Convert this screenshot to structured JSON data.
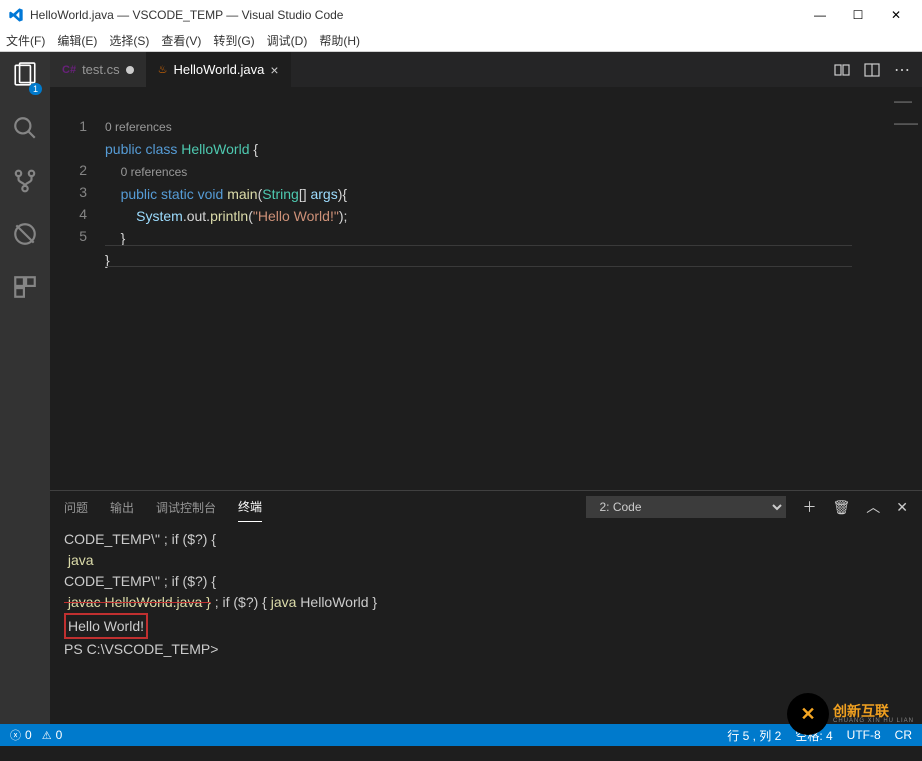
{
  "titlebar": {
    "title": "HelloWorld.java — VSCODE_TEMP — Visual Studio Code"
  },
  "menu": {
    "file": "文件(F)",
    "edit": "编辑(E)",
    "select": "选择(S)",
    "view": "查看(V)",
    "goto": "转到(G)",
    "debug": "调试(D)",
    "help": "帮助(H)"
  },
  "activity": {
    "explorer_badge": "1"
  },
  "tabs": {
    "t1_icon": "C#",
    "t1_label": "test.cs",
    "t2_label": "HelloWorld.java"
  },
  "code": {
    "ref0": "0 references",
    "ref1": "0 references",
    "l1_public": "public",
    "l1_class": "class",
    "l1_name": "HelloWorld",
    "l1_brace": "{",
    "l2_public": "public",
    "l2_static": "static",
    "l2_void": "void",
    "l2_main": "main",
    "l2_p1": "(",
    "l2_String": "String",
    "l2_arr": "[]",
    "l2_args": "args",
    "l2_p2": ")",
    "l2_brace": "{",
    "l3_sys": "System",
    "l3_out": ".out.",
    "l3_pl": "println",
    "l3_p1": "(",
    "l3_str": "\"Hello World!\"",
    "l3_p2": ");",
    "l4": "}",
    "l5": "}",
    "n1": "1",
    "n2": "2",
    "n3": "3",
    "n4": "4",
    "n5": "5"
  },
  "panel": {
    "tab_problems": "问题",
    "tab_output": "输出",
    "tab_debug": "调试控制台",
    "tab_terminal": "终端",
    "select": "2: Code"
  },
  "terminal": {
    "l1a": "CODE_TEMP\\\" ; if ($?) {",
    "l2": " java",
    "l3": "CODE_TEMP\\\" ; if ($?) {",
    "l4a": " javac HelloWorld.java }",
    "l4b": " ; if ($?) { ",
    "l4c": "java",
    "l4d": " HelloWorld }",
    "l5": "Hello World!",
    "l6": "PS C:\\VSCODE_TEMP>"
  },
  "status": {
    "err": "0",
    "warn": "0",
    "ln": "行 5 , 列 2",
    "spaces": "空格: 4",
    "enc": "UTF-8",
    "eol": "CR"
  },
  "watermark": {
    "brand": "创新互联",
    "sub": "CHUANG XIN HU LIAN"
  }
}
